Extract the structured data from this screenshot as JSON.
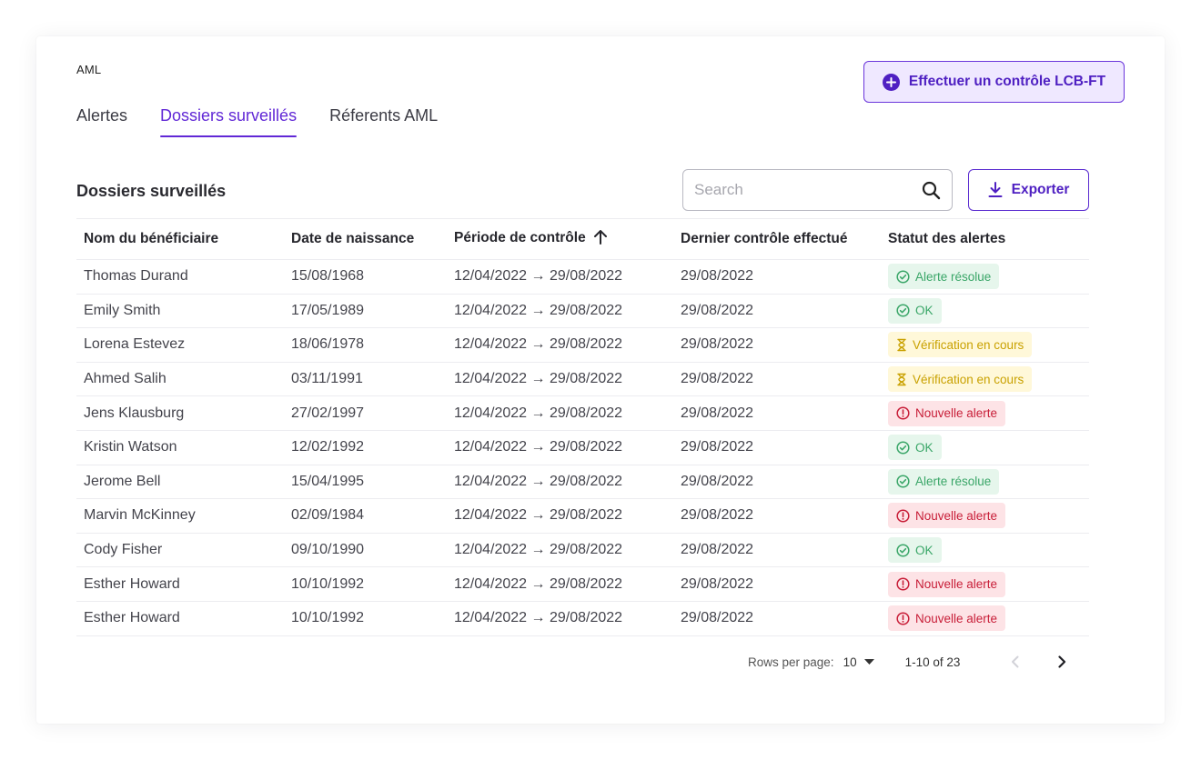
{
  "app": {
    "title": "AML"
  },
  "tabs": [
    {
      "label": "Alertes",
      "active": false
    },
    {
      "label": "Dossiers surveillés",
      "active": true
    },
    {
      "label": "Réferents AML",
      "active": false
    }
  ],
  "primary_action": {
    "label": "Effectuer un contrôle LCB-FT",
    "icon": "plus-circle-icon"
  },
  "section": {
    "title": "Dossiers surveillés"
  },
  "search": {
    "placeholder": "Search",
    "value": "",
    "icon": "search-icon"
  },
  "export": {
    "label": "Exporter",
    "icon": "download-icon"
  },
  "table": {
    "columns": [
      "Nom du bénéficiaire",
      "Date de naissance",
      "Période de contrôle",
      "Dernier contrôle effectué",
      "Statut des alertes"
    ],
    "sorted_column": "Période de contrôle",
    "sort_direction": "asc",
    "rows": [
      {
        "name": "Thomas Durand",
        "dob": "15/08/1968",
        "period": "12/04/2022 → 29/08/2022",
        "last": "29/08/2022",
        "status": "Alerte résolue",
        "status_type": "resolved"
      },
      {
        "name": "Emily Smith",
        "dob": "17/05/1989",
        "period": "12/04/2022 → 29/08/2022",
        "last": "29/08/2022",
        "status": "OK",
        "status_type": "ok"
      },
      {
        "name": "Lorena Estevez",
        "dob": "18/06/1978",
        "period": "12/04/2022 → 29/08/2022",
        "last": "29/08/2022",
        "status": "Vérification en cours",
        "status_type": "pending"
      },
      {
        "name": "Ahmed Salih",
        "dob": "03/11/1991",
        "period": "12/04/2022 → 29/08/2022",
        "last": "29/08/2022",
        "status": "Vérification en cours",
        "status_type": "pending"
      },
      {
        "name": "Jens Klausburg",
        "dob": "27/02/1997",
        "period": "12/04/2022 → 29/08/2022",
        "last": "29/08/2022",
        "status": "Nouvelle alerte",
        "status_type": "new"
      },
      {
        "name": "Kristin Watson",
        "dob": "12/02/1992",
        "period": "12/04/2022 → 29/08/2022",
        "last": "29/08/2022",
        "status": "OK",
        "status_type": "ok"
      },
      {
        "name": "Jerome Bell",
        "dob": "15/04/1995",
        "period": "12/04/2022 → 29/08/2022",
        "last": "29/08/2022",
        "status": "Alerte résolue",
        "status_type": "resolved"
      },
      {
        "name": "Marvin McKinney",
        "dob": "02/09/1984",
        "period": "12/04/2022 → 29/08/2022",
        "last": "29/08/2022",
        "status": "Nouvelle alerte",
        "status_type": "new"
      },
      {
        "name": "Cody Fisher",
        "dob": "09/10/1990",
        "period": "12/04/2022 → 29/08/2022",
        "last": "29/08/2022",
        "status": "OK",
        "status_type": "ok"
      },
      {
        "name": "Esther Howard",
        "dob": "10/10/1992",
        "period": "12/04/2022 → 29/08/2022",
        "last": "29/08/2022",
        "status": "Nouvelle alerte",
        "status_type": "new"
      },
      {
        "name": "Esther Howard",
        "dob": "10/10/1992",
        "period": "12/04/2022 → 29/08/2022",
        "last": "29/08/2022",
        "status": "Nouvelle alerte",
        "status_type": "new"
      }
    ]
  },
  "pagination": {
    "rows_per_page_label": "Rows per page:",
    "rows_per_page": "10",
    "range": "1-10 of 23",
    "prev_enabled": false,
    "next_enabled": true
  },
  "colors": {
    "accent": "#6128d6",
    "status_resolved": "#3aa668",
    "status_ok": "#3aa668",
    "status_pending": "#c9a100",
    "status_new": "#c81e38"
  }
}
